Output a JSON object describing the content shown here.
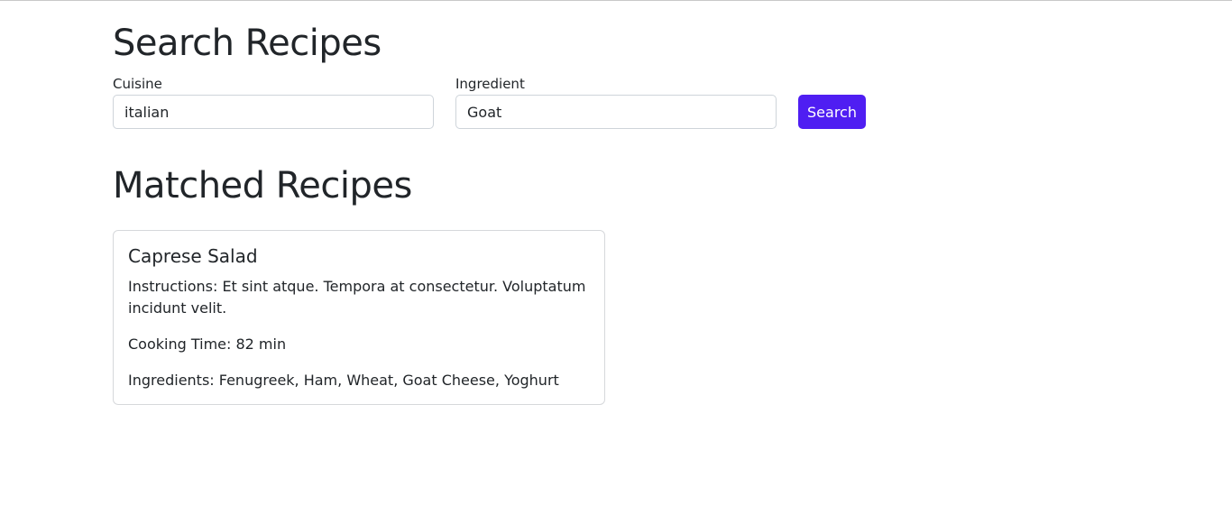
{
  "search": {
    "title": "Search Recipes",
    "cuisine_label": "Cuisine",
    "cuisine_value": "italian",
    "ingredient_label": "Ingredient",
    "ingredient_value": "Goat",
    "button_label": "Search"
  },
  "results": {
    "title": "Matched Recipes",
    "recipes": [
      {
        "name": "Caprese Salad",
        "instructions": "Instructions: Et sint atque. Tempora at consectetur. Voluptatum incidunt velit.",
        "cooking_time": "Cooking Time: 82 min",
        "ingredients": "Ingredients: Fenugreek, Ham, Wheat, Goat Cheese, Yoghurt"
      }
    ]
  },
  "colors": {
    "accent": "#4f1ef2",
    "text": "#212529",
    "border": "#ced4da"
  }
}
